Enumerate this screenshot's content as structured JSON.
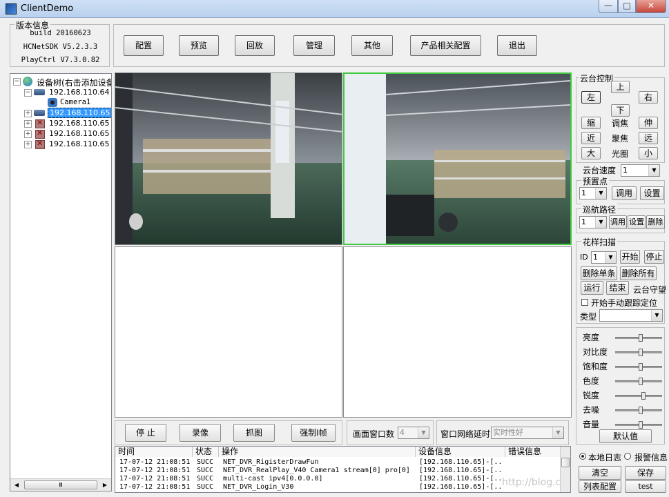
{
  "window": {
    "title": "ClientDemo",
    "min": "—",
    "max": "□",
    "close": "✕"
  },
  "version_info": {
    "title": "版本信息",
    "build": "build 20160623",
    "sdk": "HCNetSDK V5.2.3.3",
    "playctrl": "PlayCtrl V7.3.0.82"
  },
  "toolbar": [
    "配置",
    "预览",
    "回放",
    "管理",
    "其他",
    "产品相关配置",
    "退出"
  ],
  "tree": {
    "root": "设备树(右击添加设备",
    "nodes": [
      {
        "label": "192.168.110.64",
        "expander": "−",
        "icon": "device-icon"
      },
      {
        "label": "Camera1",
        "expander": "",
        "icon": "camera-icon"
      },
      {
        "label": "192.168.110.65",
        "expander": "+",
        "icon": "device-icon",
        "selected": true
      },
      {
        "label": "192.168.110.65",
        "expander": "+",
        "icon": "offline-device-icon"
      },
      {
        "label": "192.168.110.65",
        "expander": "+",
        "icon": "offline-device-icon"
      },
      {
        "label": "192.168.110.65",
        "expander": "+",
        "icon": "offline-device-icon"
      }
    ],
    "scroll_left": "◀",
    "scroll_right": "▶",
    "scroll_thumb": "Ⅲ"
  },
  "ptz": {
    "title": "云台控制",
    "up": "上",
    "left": "左",
    "right": "右",
    "down": "下",
    "zoom_out": "缩",
    "focus_label": "调焦",
    "zoom_in": "伸",
    "near": "近",
    "iris_focus_label": "聚焦",
    "far": "远",
    "big": "大",
    "iris_label": "光圈",
    "small": "小",
    "speed_label": "云台速度",
    "speed_value": "1"
  },
  "preset": {
    "title": "预置点",
    "value": "1",
    "call": "调用",
    "set": "设置"
  },
  "cruise": {
    "title": "巡航路径",
    "value": "1",
    "call": "调用",
    "set": "设置",
    "delete": "删除"
  },
  "pattern": {
    "title": "花样扫描",
    "id_label": "ID",
    "id_value": "1",
    "start": "开始",
    "stop": "停止",
    "delete_single": "删除单条",
    "delete_all": "删除所有",
    "run": "运行",
    "end": "结束",
    "guard": "云台守望",
    "manual_track": "开始手动跟踪定位",
    "type_label": "类型",
    "type_value": ""
  },
  "image_params": {
    "labels": [
      "亮度",
      "对比度",
      "饱和度",
      "色度",
      "锐度",
      "去噪",
      "音量"
    ],
    "levels": [
      0.55,
      0.55,
      0.55,
      0.55,
      0.6,
      0.55,
      0.55
    ],
    "default_button": "默认值"
  },
  "preview_controls": {
    "stop": "停 止",
    "record": "录像",
    "capture": "抓图",
    "force_iframe": "强制I帧",
    "window_count_label": "画面窗口数",
    "window_count_value": "4",
    "latency_label": "窗口网络延时",
    "latency_value": "实时性好"
  },
  "log": {
    "columns": [
      "时间",
      "状态",
      "操作",
      "设备信息",
      "错误信息"
    ],
    "rows": [
      [
        "17-07-12 21:08:51",
        "SUCC",
        "NET_DVR_RigisterDrawFun",
        "[192.168.110.65]-[..."
      ],
      [
        "17-07-12 21:08:51",
        "SUCC",
        "NET_DVR_RealPlay_V40 Camera1 stream[0] pro[0]",
        "[192.168.110.65]-[..."
      ],
      [
        "17-07-12 21:08:51",
        "SUCC",
        "multi-cast ipv4[0.0.0.0]",
        "[192.168.110.65]-[..."
      ],
      [
        "17-07-12 21:08:51",
        "SUCC",
        "NET_DVR_Login_V30",
        "[192.168.110.65]-[..."
      ]
    ],
    "watermark": "http://blog.csdn.net/..."
  },
  "log_options": {
    "local_log": "本地日志",
    "alarm_info": "报警信息",
    "clear": "清空",
    "save": "保存",
    "list_config": "列表配置",
    "test": "test"
  },
  "colors": {
    "active_video_border": "#3ecb3e",
    "selected_node": "#3399ff"
  }
}
